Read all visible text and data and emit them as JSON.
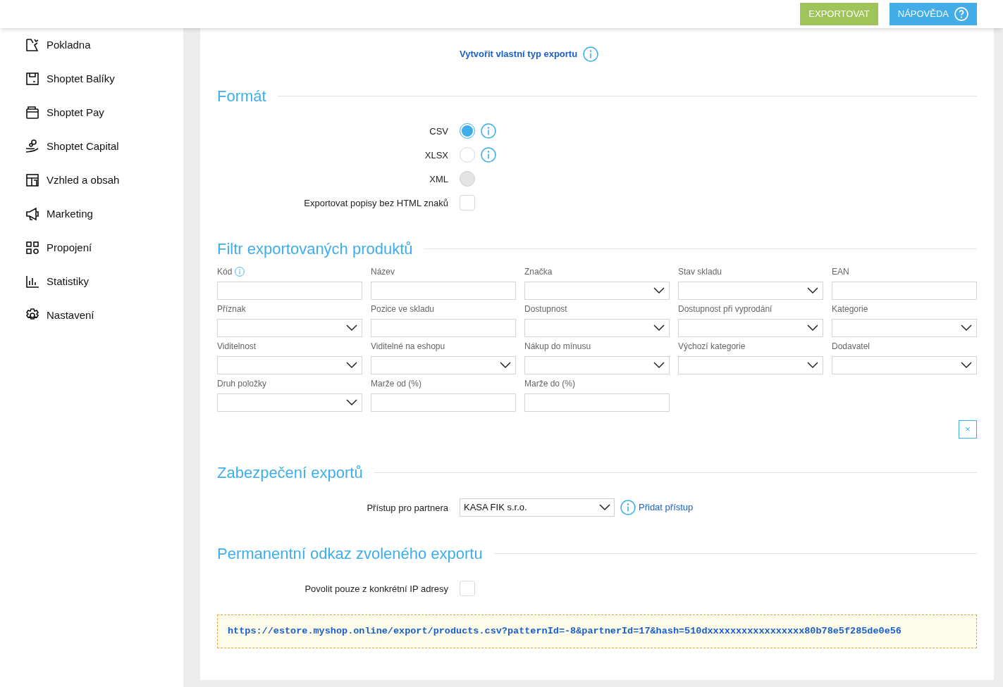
{
  "header": {
    "buttons": [
      {
        "label": "EXPORTOVAT",
        "kind": "export"
      },
      {
        "label": "NÁPOVĚDA",
        "kind": "help"
      }
    ]
  },
  "sidebar": {
    "items": [
      {
        "label": "Pokladna"
      },
      {
        "label": "Shoptet Balíky"
      },
      {
        "label": "Shoptet Pay"
      },
      {
        "label": "Shoptet Capital"
      },
      {
        "label": "Vzhled a obsah"
      },
      {
        "label": "Marketing"
      },
      {
        "label": "Propojení"
      },
      {
        "label": "Statistiky"
      },
      {
        "label": "Nastavení"
      }
    ]
  },
  "custom_export_link": "Vytvořit vlastní typ exportu",
  "format": {
    "title": "Formát",
    "options": [
      {
        "label": "CSV",
        "selected": true,
        "disabled": false,
        "info": true
      },
      {
        "label": "XLSX",
        "selected": false,
        "disabled": false,
        "info": true
      },
      {
        "label": "XML",
        "selected": false,
        "disabled": true,
        "info": false
      }
    ],
    "strip_html": {
      "label": "Exportovat popisy bez HTML znaků",
      "checked": false
    }
  },
  "filter": {
    "title": "Filtr exportovaných produktů",
    "fields": [
      {
        "label": "Kód",
        "kind": "text",
        "info": true
      },
      {
        "label": "Název",
        "kind": "text",
        "info": false
      },
      {
        "label": "Značka",
        "kind": "select",
        "info": false
      },
      {
        "label": "Stav skladu",
        "kind": "select",
        "info": false
      },
      {
        "label": "EAN",
        "kind": "text",
        "info": false
      },
      {
        "label": "Příznak",
        "kind": "select",
        "info": false
      },
      {
        "label": "Pozice ve skladu",
        "kind": "text",
        "info": false
      },
      {
        "label": "Dostupnost",
        "kind": "select",
        "info": false
      },
      {
        "label": "Dostupnost při vyprodání",
        "kind": "select",
        "info": false
      },
      {
        "label": "Kategorie",
        "kind": "select",
        "info": false
      },
      {
        "label": "Viditelnost",
        "kind": "select",
        "info": false
      },
      {
        "label": "Viditelné na eshopu",
        "kind": "select",
        "info": false
      },
      {
        "label": "Nákup do mínusu",
        "kind": "select",
        "info": false
      },
      {
        "label": "Výchozí kategorie",
        "kind": "select",
        "info": false
      },
      {
        "label": "Dodavatel",
        "kind": "select",
        "info": false
      },
      {
        "label": "Druh položky",
        "kind": "select",
        "info": false
      },
      {
        "label": "Marže od (%)",
        "kind": "text",
        "info": false
      },
      {
        "label": "Marže do (%)",
        "kind": "text",
        "info": false
      }
    ],
    "clear_button": "×"
  },
  "security": {
    "title": "Zabezpečení exportů",
    "partner_label": "Přístup pro partnera",
    "partner_value": "KASA FIK s.r.o.",
    "add_link": "Přidat přístup"
  },
  "permalink": {
    "title": "Permanentní odkaz zvoleného exportu",
    "ip_label": "Povolit pouze z konkrétní IP adresy",
    "ip_checked": false,
    "url": "https://estore.myshop.online/export/products.csv?patternId=-8&partnerId=17&hash=510dxxxxxxxxxxxxxxxxx80b78e5f285de0e56"
  }
}
